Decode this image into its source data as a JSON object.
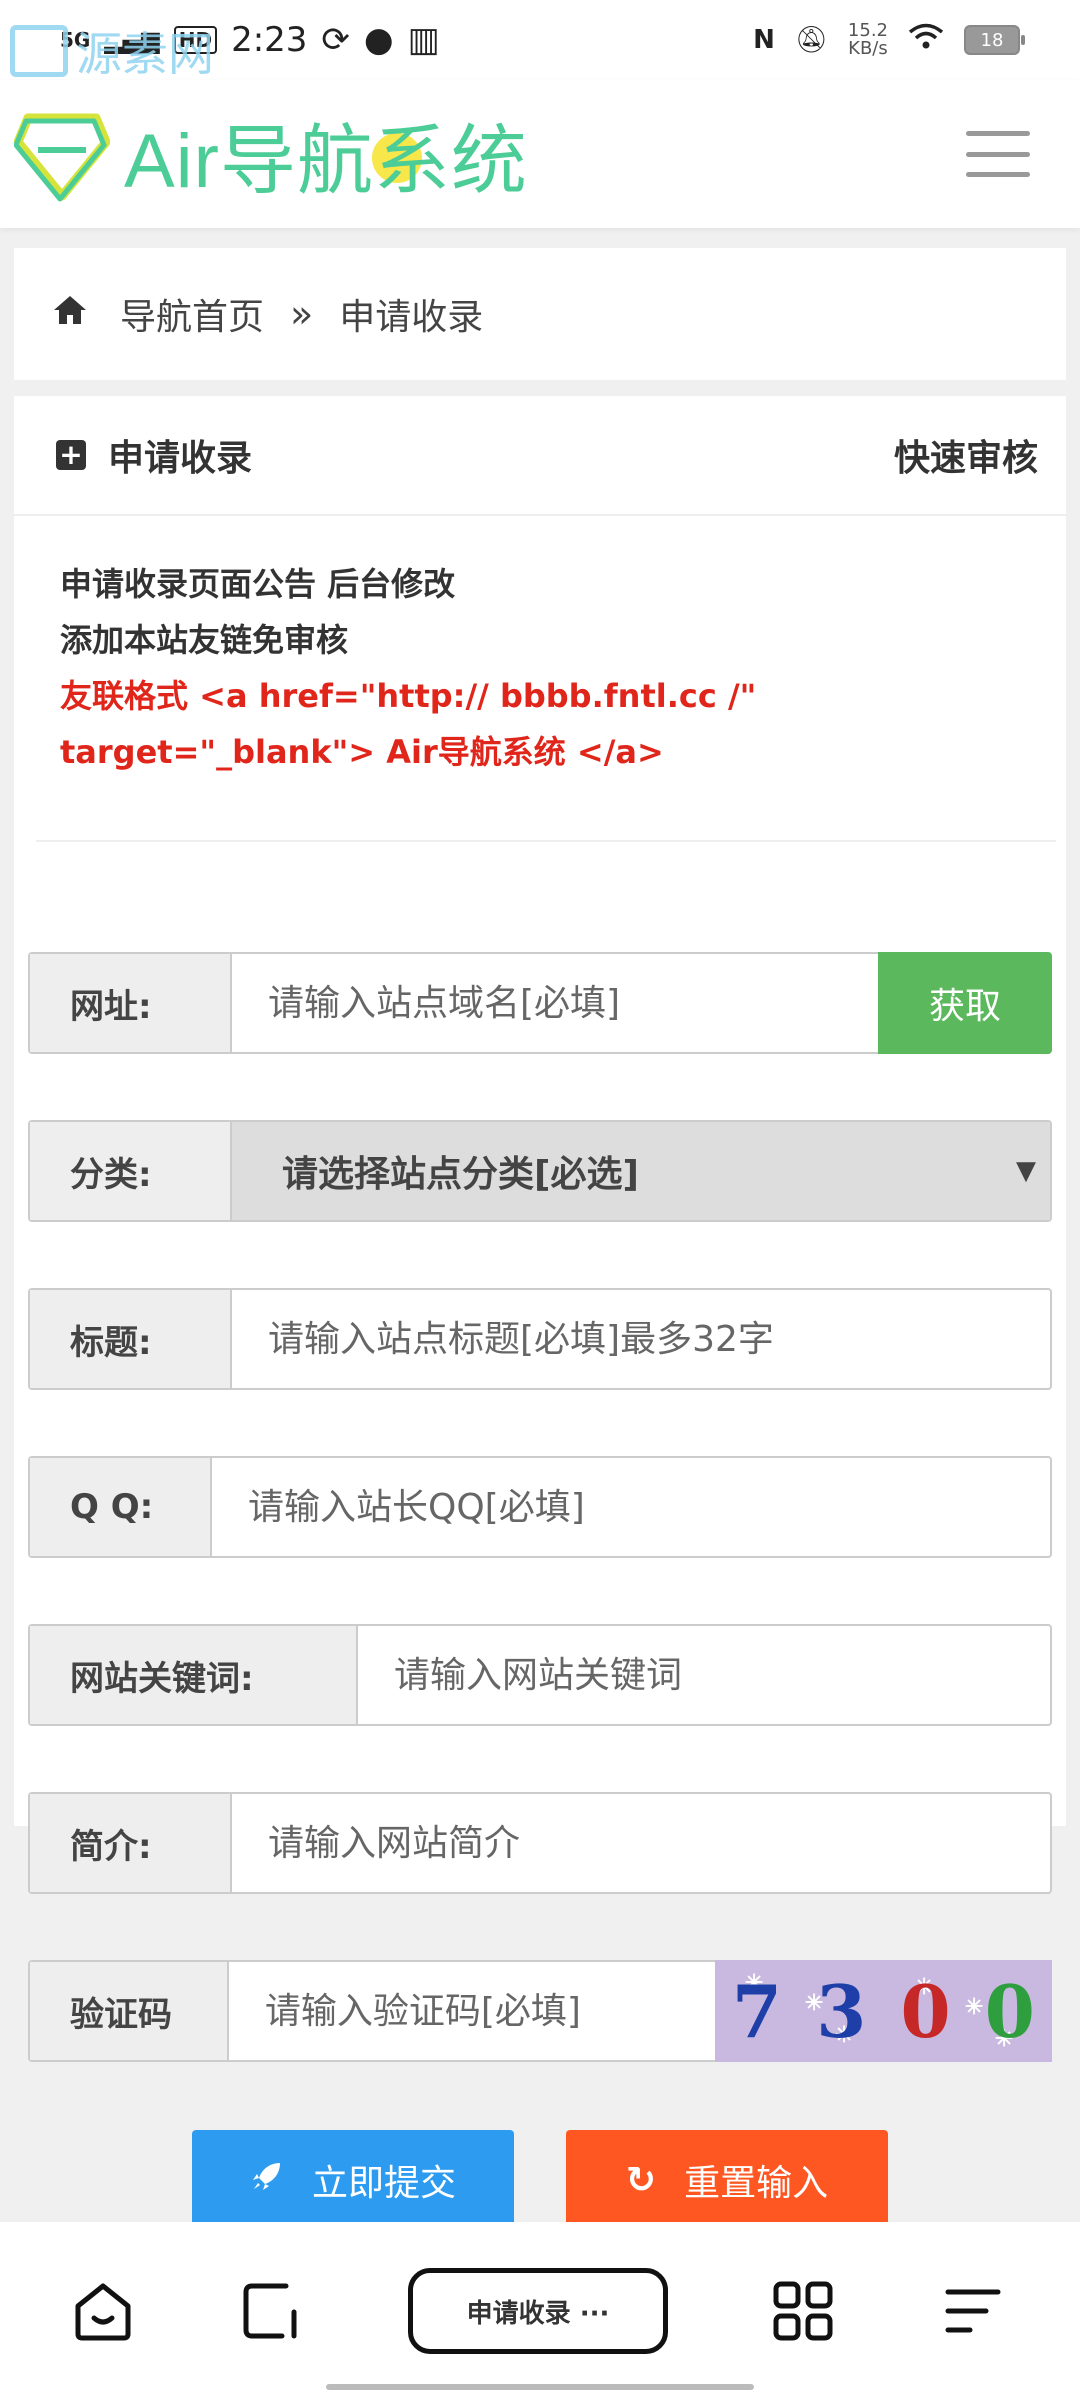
{
  "status": {
    "signal": "5G",
    "hd": "HD",
    "time": "2:23",
    "net_speed": "15.2",
    "net_unit": "KB/s",
    "battery": "18"
  },
  "watermark": "源素网",
  "header": {
    "title": "Air导航系统",
    "brand_color": "#4ccd97"
  },
  "breadcrumb": {
    "home": "导航首页",
    "separator": "»",
    "current": "申请收录"
  },
  "card": {
    "title": "申请收录",
    "right_link": "快速审核"
  },
  "notice": {
    "line1": "申请收录页面公告 后台修改",
    "line2": "添加本站友链免审核",
    "line3": "友联格式 <a href=\"http:// bbbb.fntl.cc /\"",
    "line4": "target=\"_blank\"> Air导航系统 </a>"
  },
  "form": {
    "url": {
      "label": "网址:",
      "placeholder": "请输入站点域名[必填]",
      "button": "获取"
    },
    "category": {
      "label": "分类:",
      "selected": "请选择站点分类[必选]"
    },
    "title": {
      "label": "标题:",
      "placeholder": "请输入站点标题[必填]最多32字"
    },
    "qq": {
      "label": "Q Q:",
      "placeholder": "请输入站长QQ[必填]"
    },
    "keywords": {
      "label": "网站关键词:",
      "placeholder": "请输入网站关键词"
    },
    "intro": {
      "label": "简介:",
      "placeholder": "请输入网站简介"
    },
    "captcha": {
      "label": "验证码",
      "placeholder": "请输入验证码[必填]",
      "digits": [
        "7",
        "3",
        "0",
        "0"
      ]
    }
  },
  "buttons": {
    "submit": "立即提交",
    "reset": "重置输入"
  },
  "bottom_nav": {
    "pill": "申请收录 ···"
  }
}
